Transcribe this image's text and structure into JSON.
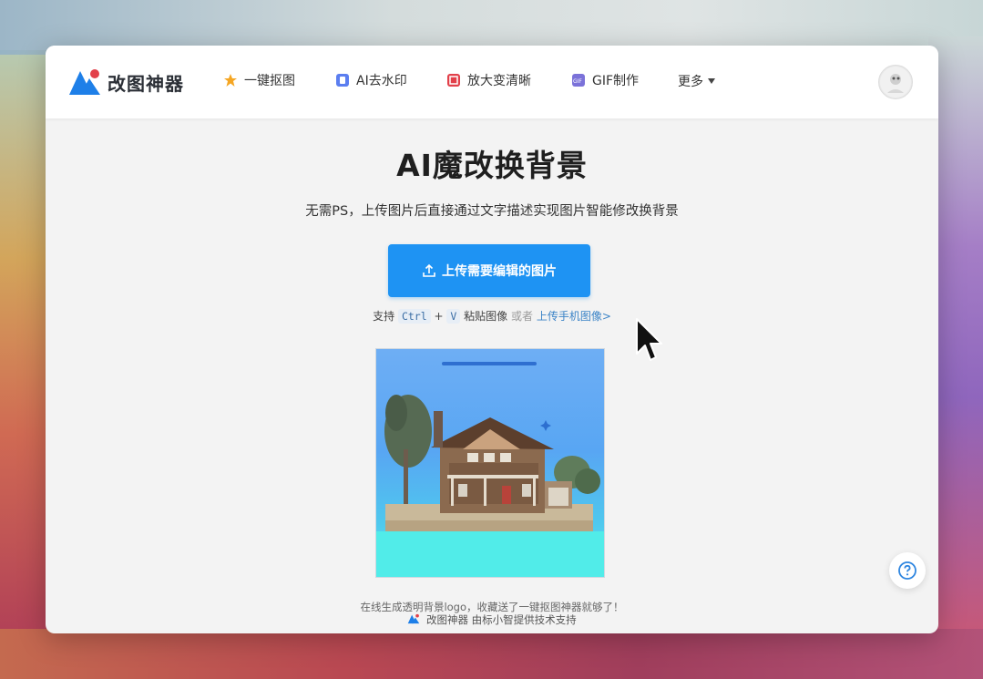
{
  "brand": {
    "name": "改图神器",
    "accent_color": "#1e93f3",
    "logo_colors": [
      "#1e7fe8",
      "#e2404a"
    ]
  },
  "nav": {
    "items": [
      {
        "label": "一键抠图",
        "icon": "star-icon",
        "color": "#f5a623"
      },
      {
        "label": "AI去水印",
        "icon": "watermark-icon",
        "color": "#5b7ef0"
      },
      {
        "label": "放大变清晰",
        "icon": "enlarge-icon",
        "color": "#e2404a"
      },
      {
        "label": "GIF制作",
        "icon": "gif-icon",
        "color": "#7b72d9"
      }
    ],
    "more_label": "更多"
  },
  "hero": {
    "title": "AI魔改换背景",
    "subtitle": "无需PS，上传图片后直接通过文字描述实现图片智能修改换背景",
    "upload_button_label": "上传需要编辑的图片",
    "hint_prefix": "支持",
    "hint_key1": "Ctrl",
    "hint_plus": "+",
    "hint_key2": "V",
    "hint_paste": "粘贴图像",
    "hint_or": "或者",
    "hint_phone_link": "上传手机图像>"
  },
  "preview": {
    "image_subject": "house-photo",
    "progress": 1.0
  },
  "footer": {
    "line1": "在线生成透明背景logo，收藏送了一键抠图神器就够了！",
    "line2": "改图神器 由标小智提供技术支持"
  },
  "help": {
    "icon": "question-icon"
  }
}
